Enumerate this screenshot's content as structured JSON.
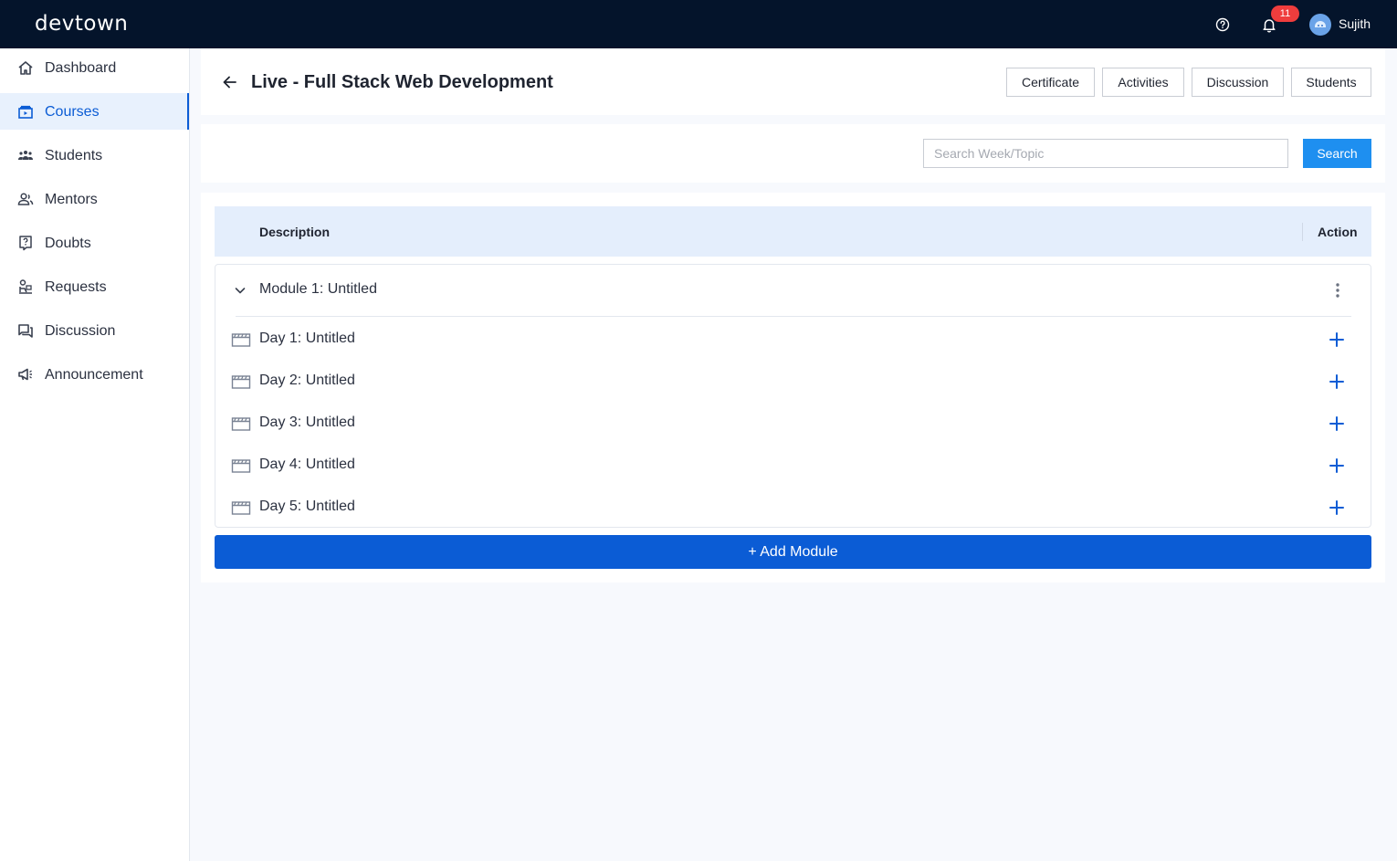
{
  "app": {
    "logo": "devtown",
    "notifications_count": "11",
    "user_name": "Sujith"
  },
  "sidebar": {
    "items": [
      {
        "label": "Dashboard",
        "icon": "home-icon"
      },
      {
        "label": "Courses",
        "icon": "courses-icon",
        "active": true
      },
      {
        "label": "Students",
        "icon": "students-icon"
      },
      {
        "label": "Mentors",
        "icon": "mentors-icon"
      },
      {
        "label": "Doubts",
        "icon": "doubts-icon"
      },
      {
        "label": "Requests",
        "icon": "requests-icon"
      },
      {
        "label": "Discussion",
        "icon": "discussion-icon"
      },
      {
        "label": "Announcement",
        "icon": "megaphone-icon"
      }
    ]
  },
  "header": {
    "title": "Live - Full Stack Web Development",
    "buttons": [
      "Certificate",
      "Activities",
      "Discussion",
      "Students"
    ]
  },
  "search": {
    "placeholder": "Search Week/Topic",
    "value": "",
    "button_label": "Search"
  },
  "table": {
    "col_description": "Description",
    "col_action": "Action"
  },
  "module": {
    "title": "Module 1: Untitled",
    "days": [
      "Day 1: Untitled",
      "Day 2: Untitled",
      "Day 3: Untitled",
      "Day 4: Untitled",
      "Day 5: Untitled"
    ]
  },
  "add_module_label": "+ Add Module",
  "colors": {
    "topbar": "#04142b",
    "primary": "#0b5cd5",
    "search_button": "#1e8ff0",
    "badge": "#ef3d3d",
    "table_header": "#e4eefc"
  }
}
